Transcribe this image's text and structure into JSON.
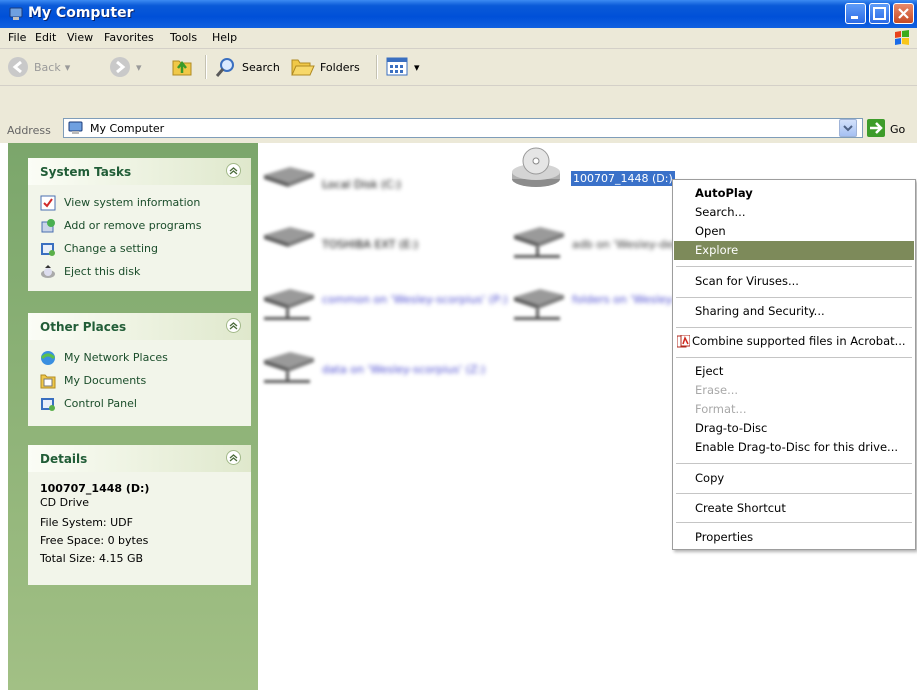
{
  "window": {
    "title": "My Computer"
  },
  "menubar": [
    "File",
    "Edit",
    "View",
    "Favorites",
    "Tools",
    "Help"
  ],
  "toolbar": {
    "back": "Back",
    "search": "Search",
    "folders": "Folders"
  },
  "address": {
    "label": "Address",
    "value": "My Computer",
    "go": "Go"
  },
  "system_tasks": {
    "title": "System Tasks",
    "items": [
      "View system information",
      "Add or remove programs",
      "Change a setting",
      "Eject this disk"
    ]
  },
  "other_places": {
    "title": "Other Places",
    "items": [
      "My Network Places",
      "My Documents",
      "Control Panel"
    ]
  },
  "details": {
    "title": "Details",
    "name": "100707_1448 (D:)",
    "type": "CD Drive",
    "filesystem": "File System: UDF",
    "free": "Free Space: 0 bytes",
    "total": "Total Size: 4.15 GB"
  },
  "drives": {
    "cd_label": "100707_1448 (D:)",
    "blurred": [
      "Local Disk (C:)",
      "TOSHIBA EXT (E:)",
      "adb on 'Wesley-desktop'",
      "common on 'Wesley-scorpius' (P:)",
      "folders on 'Wesley-scorpius'",
      "data on 'Wesley-scorpius' (Z:)"
    ]
  },
  "context_menu": {
    "items": [
      "AutoPlay",
      "Search...",
      "Open",
      "Explore",
      "Scan for Viruses...",
      "Sharing and Security...",
      "Combine supported files in Acrobat...",
      "Eject",
      "Erase...",
      "Format...",
      "Drag-to-Disc",
      "Enable Drag-to-Disc for this drive...",
      "Copy",
      "Create Shortcut",
      "Properties"
    ]
  },
  "colors": {
    "title_blue": "#0050d8",
    "task_green": "#7ba66b",
    "menu_highlight": "#7d8a5a"
  }
}
